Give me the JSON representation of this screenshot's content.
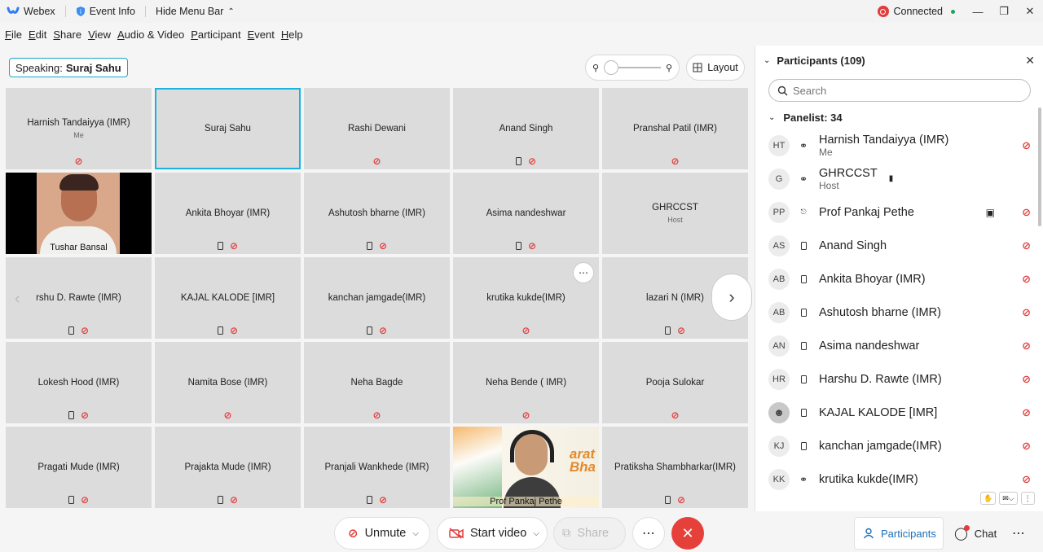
{
  "titlebar": {
    "app": "Webex",
    "event_info": "Event Info",
    "hide_menu": "Hide Menu Bar",
    "status": "Connected"
  },
  "menubar": [
    "File",
    "Edit",
    "Share",
    "View",
    "Audio & Video",
    "Participant",
    "Event",
    "Help"
  ],
  "stage": {
    "speaking_label": "Speaking:",
    "speaking_name": "Suraj Sahu",
    "layout_label": "Layout"
  },
  "tiles": [
    {
      "name": "Harnish Tandaiyya (IMR)",
      "sub": "Me",
      "phone": false,
      "mic": true
    },
    {
      "name": "Suraj Sahu",
      "sub": "",
      "phone": false,
      "mic": false
    },
    {
      "name": "Rashi Dewani",
      "sub": "",
      "phone": false,
      "mic": true
    },
    {
      "name": "Anand Singh",
      "sub": "",
      "phone": true,
      "mic": true
    },
    {
      "name": "Pranshal Patil (IMR)",
      "sub": "",
      "phone": false,
      "mic": true
    },
    {
      "name": "Tushar Bansal",
      "sub": "",
      "phone": false,
      "mic": false
    },
    {
      "name": "Ankita Bhoyar (IMR)",
      "sub": "",
      "phone": true,
      "mic": true
    },
    {
      "name": "Ashutosh bharne (IMR)",
      "sub": "",
      "phone": true,
      "mic": true
    },
    {
      "name": "Asima nandeshwar",
      "sub": "",
      "phone": true,
      "mic": true
    },
    {
      "name": "GHRCCST",
      "sub": "Host",
      "phone": false,
      "mic": false
    },
    {
      "name": "rshu D. Rawte (IMR)",
      "sub": "",
      "phone": true,
      "mic": true
    },
    {
      "name": "KAJAL KALODE [IMR]",
      "sub": "",
      "phone": true,
      "mic": true
    },
    {
      "name": "kanchan jamgade(IMR)",
      "sub": "",
      "phone": true,
      "mic": true
    },
    {
      "name": "krutika kukde(IMR)",
      "sub": "",
      "phone": false,
      "mic": true
    },
    {
      "name": "lazari N (IMR)",
      "sub": "",
      "phone": true,
      "mic": true
    },
    {
      "name": "Lokesh Hood (IMR)",
      "sub": "",
      "phone": true,
      "mic": true
    },
    {
      "name": "Namita Bose (IMR)",
      "sub": "",
      "phone": false,
      "mic": true
    },
    {
      "name": "Neha Bagde",
      "sub": "",
      "phone": false,
      "mic": true
    },
    {
      "name": "Neha Bende ( IMR)",
      "sub": "",
      "phone": false,
      "mic": true
    },
    {
      "name": "Pooja Sulokar",
      "sub": "",
      "phone": false,
      "mic": true
    },
    {
      "name": "Pragati Mude (IMR)",
      "sub": "",
      "phone": true,
      "mic": true
    },
    {
      "name": "Prajakta Mude (IMR)",
      "sub": "",
      "phone": true,
      "mic": true
    },
    {
      "name": "Pranjali Wankhede (IMR)",
      "sub": "",
      "phone": true,
      "mic": true
    },
    {
      "name": "Prof Pankaj Pethe",
      "sub": "",
      "phone": false,
      "mic": false
    },
    {
      "name": "Pratiksha Shambharkar(IMR)",
      "sub": "",
      "phone": true,
      "mic": true
    }
  ],
  "video_bg_text": "arat\nBha",
  "controls": {
    "unmute": "Unmute",
    "start_video": "Start video",
    "share": "Share",
    "participants": "Participants",
    "chat": "Chat"
  },
  "panel": {
    "title": "Participants (109)",
    "search_placeholder": "Search",
    "panelist_header": "Panelist: 34",
    "participants": [
      {
        "initials": "HT",
        "name": "Harnish Tandaiyya (IMR)",
        "role": "Me",
        "device": "headset",
        "mic": true
      },
      {
        "initials": "G",
        "name": "GHRCCST",
        "role": "Host",
        "device": "headset",
        "mic": false,
        "bars": true
      },
      {
        "initials": "PP",
        "name": "Prof Pankaj Pethe",
        "role": "",
        "device": "none",
        "mic": true,
        "cam": true
      },
      {
        "initials": "AS",
        "name": "Anand Singh",
        "role": "",
        "device": "phone",
        "mic": true
      },
      {
        "initials": "AB",
        "name": "Ankita Bhoyar (IMR)",
        "role": "",
        "device": "phone",
        "mic": true
      },
      {
        "initials": "AB",
        "name": "Ashutosh bharne (IMR)",
        "role": "",
        "device": "phone",
        "mic": true
      },
      {
        "initials": "AN",
        "name": "Asima nandeshwar",
        "role": "",
        "device": "phone",
        "mic": true
      },
      {
        "initials": "HR",
        "name": "Harshu D. Rawte (IMR)",
        "role": "",
        "device": "phone",
        "mic": true
      },
      {
        "initials": "",
        "name": "KAJAL KALODE [IMR]",
        "role": "",
        "device": "phone",
        "mic": true,
        "photo": true
      },
      {
        "initials": "KJ",
        "name": "kanchan jamgade(IMR)",
        "role": "",
        "device": "phone",
        "mic": true
      },
      {
        "initials": "KK",
        "name": "krutika kukde(IMR)",
        "role": "",
        "device": "headset",
        "mic": true
      }
    ]
  }
}
